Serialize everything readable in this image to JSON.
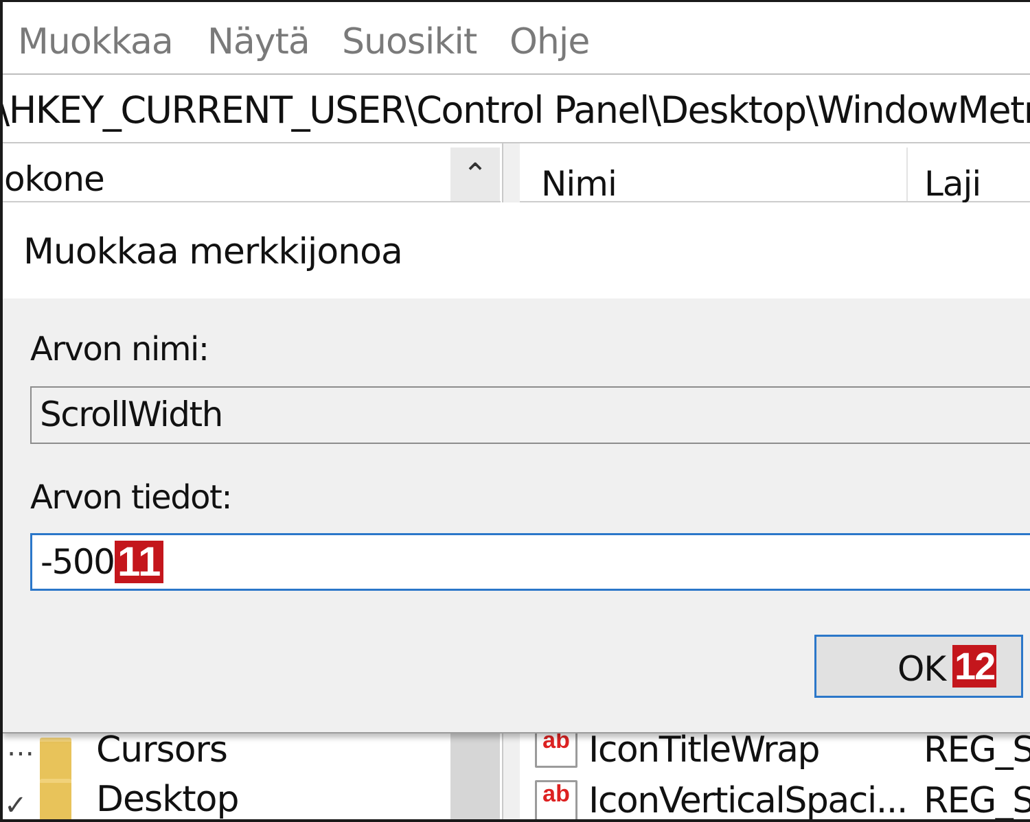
{
  "menubar": {
    "items": [
      {
        "label": "Muokkaa"
      },
      {
        "label": "Näytä"
      },
      {
        "label": "Suosikit"
      },
      {
        "label": "Ohje"
      }
    ]
  },
  "address": {
    "path": "\\HKEY_CURRENT_USER\\Control Panel\\Desktop\\WindowMetri"
  },
  "tree_pane": {
    "header": "okone",
    "items": [
      {
        "label": "Cursors"
      },
      {
        "label": "Desktop"
      }
    ]
  },
  "list_pane": {
    "columns": [
      {
        "label": "Nimi"
      },
      {
        "label": "Laji"
      }
    ],
    "rows": [
      {
        "name": "IconTitleWrap",
        "type": "REG_S",
        "icon": "ab"
      },
      {
        "name": "IconVerticalSpaci...",
        "type": "REG_S",
        "icon": "ab"
      }
    ]
  },
  "dialog": {
    "title": "Muokkaa merkkijonoa",
    "name_label": "Arvon nimi:",
    "name_value": "ScrollWidth",
    "data_label": "Arvon tiedot:",
    "data_value": "-500",
    "ok_label": "OK"
  },
  "annotations": {
    "step_data": "11",
    "step_ok": "12",
    "badge_color": "#c4161c"
  },
  "colors": {
    "focus_border": "#2b77c9",
    "dialog_bg": "#f0f0f0"
  }
}
